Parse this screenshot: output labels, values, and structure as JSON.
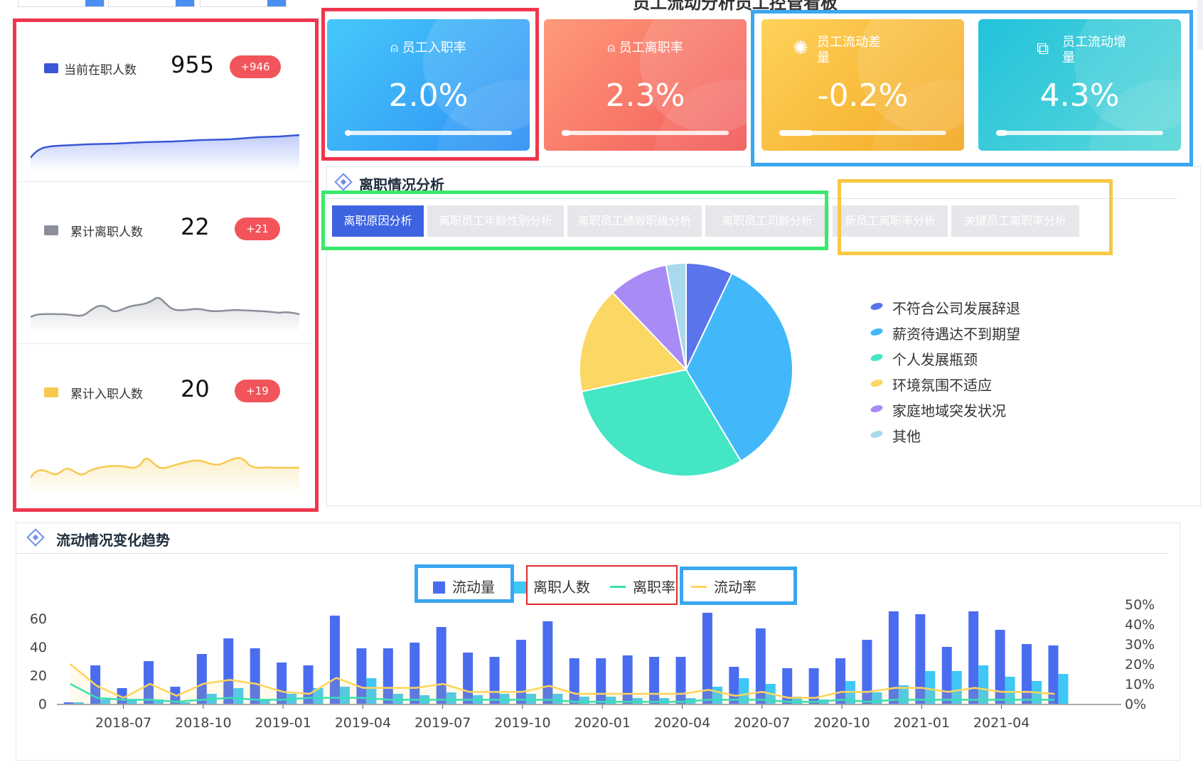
{
  "page": {
    "title": "员工流动分析员工控管看板"
  },
  "metrics": [
    {
      "label": "当前在职人数",
      "value": "955",
      "badge": "+946",
      "color": "#3a56d6"
    },
    {
      "label": "累计离职人数",
      "value": "22",
      "badge": "+21",
      "color": "#8a8f99"
    },
    {
      "label": "累计入职人数",
      "value": "20",
      "badge": "+19",
      "color": "#f7c94e"
    }
  ],
  "kpis": [
    {
      "label": "员工入职率",
      "value": "2.0%",
      "icon": "user-plus-icon",
      "progress": 0.02
    },
    {
      "label": "员工离职率",
      "value": "2.3%",
      "icon": "user-remove-icon",
      "progress": 0.023
    },
    {
      "label": "员工流动差",
      "label2": "量",
      "value": "-0.2%",
      "icon": "atom-icon",
      "progress": 0.12
    },
    {
      "label": "员工流动增",
      "label2": "量",
      "value": "4.3%",
      "icon": "trend-chart-icon",
      "progress": 0.043
    }
  ],
  "leave_panel": {
    "title": "离职情况分析",
    "tabs": [
      "离职原因分析",
      "离职员工年龄性别分析",
      "离职员工绩效职级分析",
      "离职员工司龄分析",
      "新员工离职率分析",
      "关键员工离职率分析"
    ],
    "active_tab": 0
  },
  "trend_panel": {
    "title": "流动情况变化趋势",
    "legend": [
      "流动量",
      "离职人数",
      "离职率",
      "流动率"
    ]
  },
  "colors": {
    "blue_dark": "#4a6df0",
    "blue_light": "#3fc7f5",
    "green": "#39e0b0",
    "yellow": "#ffd45a",
    "red_badge": "#f2545b"
  },
  "chart_data": [
    {
      "type": "pie",
      "categories": [
        "不符合公司发展辞退",
        "薪资待遇达不到期望",
        "个人发展瓶颈",
        "环境氛围不适应",
        "家庭地域突发状况",
        "其他"
      ],
      "values": [
        7,
        34,
        30,
        16,
        9,
        3
      ],
      "colors": [
        "#5a74eb",
        "#42b8fb",
        "#44e6c4",
        "#fbd763",
        "#a98bf5",
        "#a8d9ec"
      ],
      "legend_position": "right"
    },
    {
      "type": "bar",
      "x": [
        "2018-05",
        "2018-06",
        "2018-07",
        "2018-08",
        "2018-09",
        "2018-10",
        "2018-11",
        "2018-12",
        "2019-01",
        "2019-02",
        "2019-03",
        "2019-04",
        "2019-05",
        "2019-06",
        "2019-07",
        "2019-08",
        "2019-09",
        "2019-10",
        "2019-11",
        "2019-12",
        "2020-01",
        "2020-02",
        "2020-03",
        "2020-04",
        "2020-05",
        "2020-06",
        "2020-07",
        "2020-08",
        "2020-09",
        "2020-10",
        "2020-11",
        "2020-12",
        "2021-01",
        "2021-02",
        "2021-03",
        "2021-04",
        "2021-05",
        "2021-06",
        "2021-07",
        "2021-08"
      ],
      "x_tick_labels": [
        "2018-07",
        "2018-10",
        "2019-01",
        "2019-04",
        "2019-07",
        "2019-10",
        "2020-01",
        "2020-04",
        "2020-07",
        "2020-10",
        "2021-01",
        "2021-04"
      ],
      "series": [
        {
          "name": "流动量",
          "kind": "bar",
          "axis": "left",
          "values": [
            1,
            27,
            11,
            30,
            12,
            35,
            46,
            39,
            29,
            27,
            62,
            39,
            39,
            43,
            54,
            36,
            33,
            45,
            58,
            32,
            32,
            34,
            33,
            33,
            64,
            26,
            53,
            25,
            25,
            32,
            45,
            65,
            63,
            40,
            65,
            52,
            42,
            41,
            0,
            0
          ]
        },
        {
          "name": "离职人数",
          "kind": "bar",
          "axis": "left",
          "values": [
            1,
            3,
            3,
            3,
            1,
            7,
            11,
            3,
            7,
            11,
            12,
            18,
            7,
            6,
            8,
            6,
            7,
            7,
            7,
            5,
            5,
            4,
            4,
            4,
            12,
            18,
            14,
            5,
            3,
            16,
            8,
            13,
            23,
            23,
            27,
            19,
            16,
            21,
            0,
            0
          ]
        },
        {
          "name": "离职率",
          "kind": "line",
          "axis": "right",
          "values": [
            10,
            3,
            2,
            2,
            1,
            2,
            3,
            2,
            2,
            3,
            3,
            3,
            2,
            2,
            2,
            2,
            2,
            2,
            2,
            1,
            1,
            1,
            1,
            1,
            2,
            2,
            2,
            1,
            1,
            2,
            1,
            2,
            2,
            2,
            2,
            2,
            2,
            2,
            0,
            0
          ]
        },
        {
          "name": "流动率",
          "kind": "line",
          "axis": "right",
          "values": [
            20,
            9,
            3,
            10,
            4,
            10,
            12,
            10,
            6,
            5,
            13,
            8,
            8,
            8,
            10,
            6,
            6,
            6,
            9,
            5,
            5,
            5,
            5,
            5,
            7,
            4,
            6,
            3,
            3,
            6,
            6,
            8,
            8,
            6,
            8,
            6,
            6,
            5,
            0,
            0
          ]
        }
      ],
      "ylim_left": [
        0,
        60
      ],
      "yticks_left": [
        0,
        20,
        40,
        60
      ],
      "ylim_right": [
        0,
        50
      ],
      "yticks_right": [
        "0%",
        "10%",
        "20%",
        "30%",
        "40%",
        "50%"
      ]
    }
  ]
}
